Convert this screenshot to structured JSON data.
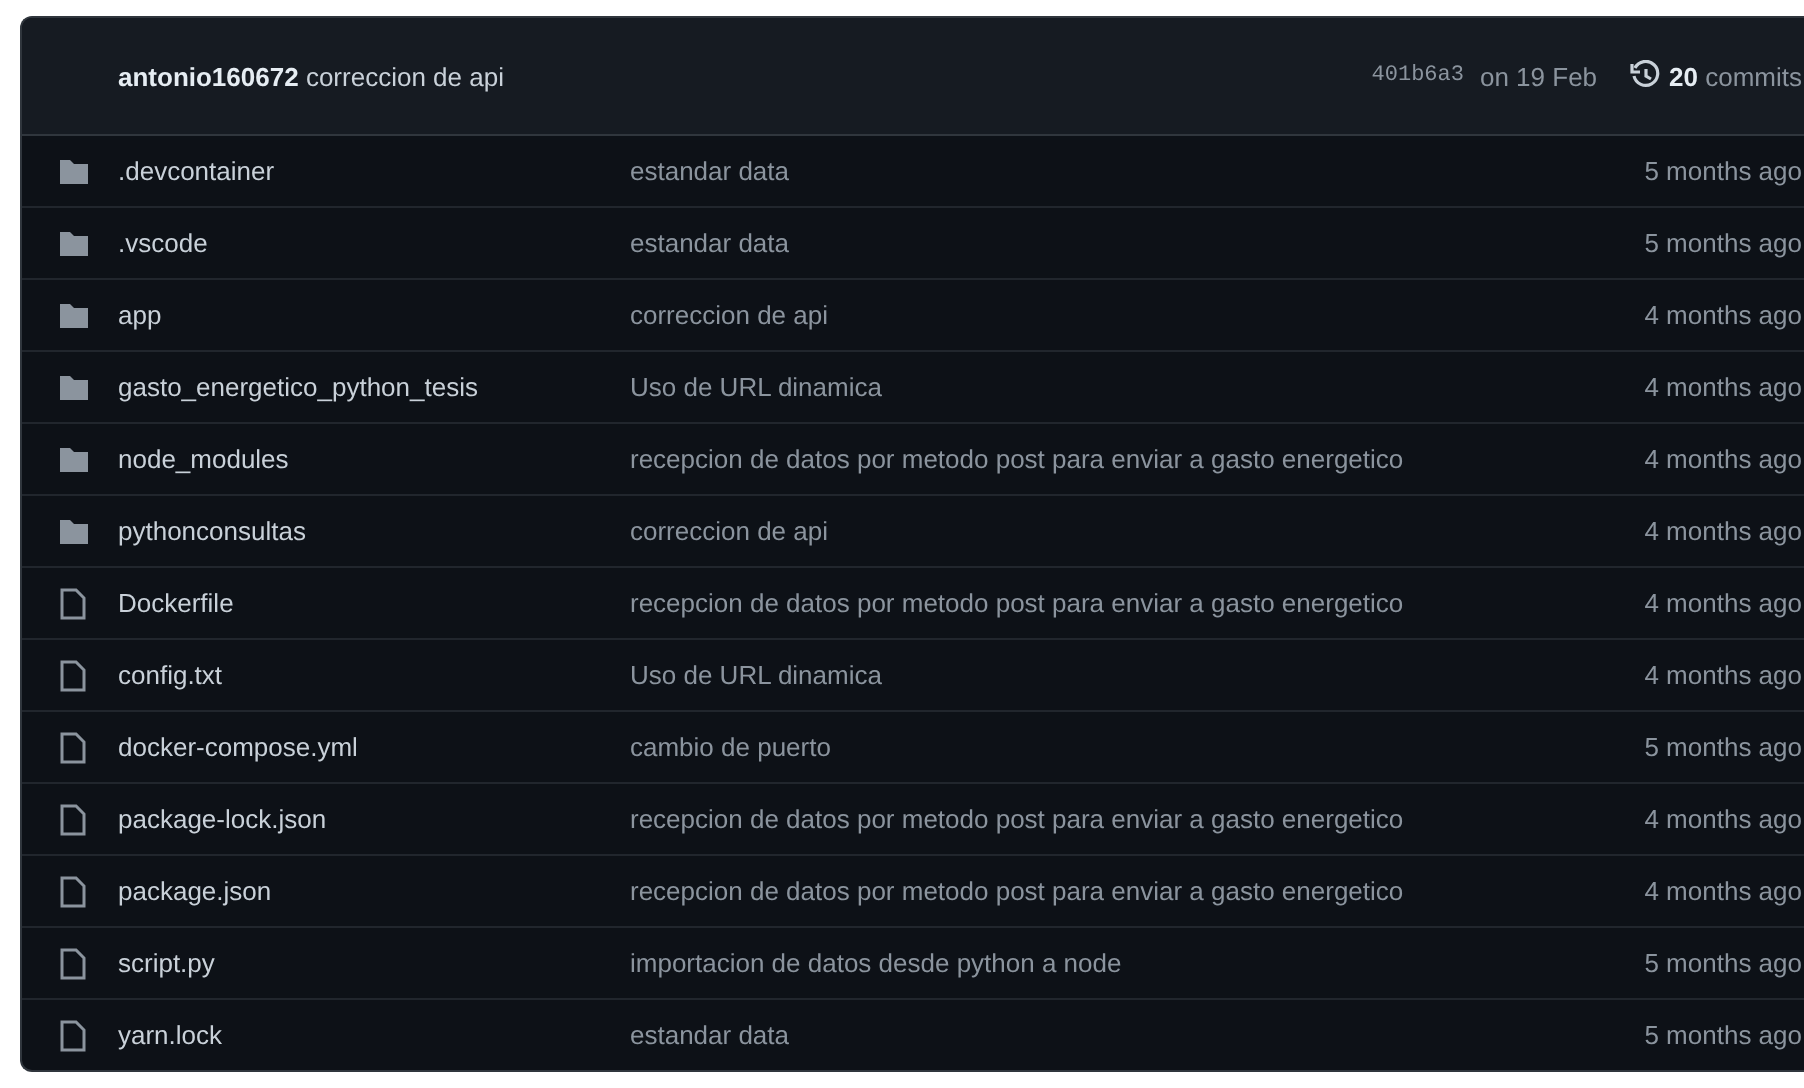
{
  "latest_commit": {
    "author": "antonio160672",
    "message": "correccion de api",
    "sha": "401b6a3",
    "date": "on 19 Feb",
    "commits": "**20** commits"
  },
  "files": [
    {
      "kind": "folder",
      "name": ".devcontainer",
      "message": "estandar data",
      "age": "5 months ago"
    },
    {
      "kind": "folder",
      "name": ".vscode",
      "message": "estandar data",
      "age": "5 months ago"
    },
    {
      "kind": "folder",
      "name": "app",
      "message": "correccion de api",
      "age": "4 months ago"
    },
    {
      "kind": "folder",
      "name": "gasto_energetico_python_tesis",
      "message": "Uso de URL dinamica",
      "age": "4 months ago"
    },
    {
      "kind": "folder",
      "name": "node_modules",
      "message": "recepcion de datos por metodo post para enviar a gasto energetico",
      "age": "4 months ago"
    },
    {
      "kind": "folder",
      "name": "pythonconsultas",
      "message": "correccion de api",
      "age": "4 months ago"
    },
    {
      "kind": "file",
      "name": "Dockerfile",
      "message": "recepcion de datos por metodo post para enviar a gasto energetico",
      "age": "4 months ago"
    },
    {
      "kind": "file",
      "name": "config.txt",
      "message": "Uso de URL dinamica",
      "age": "4 months ago"
    },
    {
      "kind": "file",
      "name": "docker-compose.yml",
      "message": "cambio de puerto",
      "age": "5 months ago"
    },
    {
      "kind": "file",
      "name": "package-lock.json",
      "message": "recepcion de datos por metodo post para enviar a gasto energetico",
      "age": "4 months ago"
    },
    {
      "kind": "file",
      "name": "package.json",
      "message": "recepcion de datos por metodo post para enviar a gasto energetico",
      "age": "4 months ago"
    },
    {
      "kind": "file",
      "name": "script.py",
      "message": "importacion de datos desde python a node",
      "age": "5 months ago"
    },
    {
      "kind": "file",
      "name": "yarn.lock",
      "message": "estandar data",
      "age": "5 months ago"
    }
  ]
}
